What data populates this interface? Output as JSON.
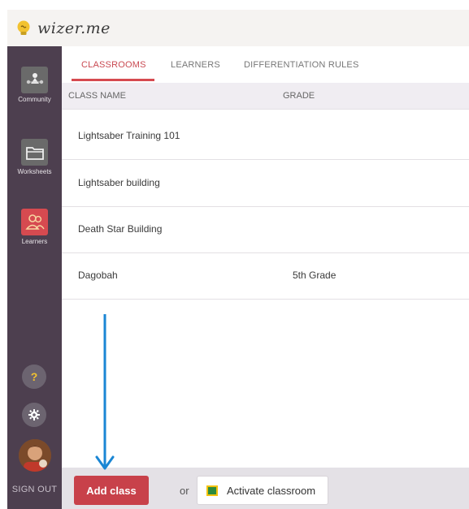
{
  "brand": {
    "name": "wizer.me"
  },
  "sidebar": {
    "items": [
      {
        "label": "Community",
        "icon": "community-icon"
      },
      {
        "label": "Worksheets",
        "icon": "folder-icon"
      },
      {
        "label": "Learners",
        "icon": "learners-icon",
        "active": true
      }
    ],
    "help_label": "?",
    "signout_label": "SIGN OUT"
  },
  "tabs": [
    {
      "label": "CLASSROOMS",
      "active": true
    },
    {
      "label": "LEARNERS",
      "active": false
    },
    {
      "label": "DIFFERENTIATION RULES",
      "active": false
    }
  ],
  "table": {
    "columns": [
      "CLASS NAME",
      "GRADE"
    ],
    "rows": [
      {
        "name": "Lightsaber Training 101",
        "grade": ""
      },
      {
        "name": "Lightsaber building",
        "grade": ""
      },
      {
        "name": "Death Star Building",
        "grade": ""
      },
      {
        "name": "Dagobah",
        "grade": "5th Grade"
      }
    ]
  },
  "footer": {
    "add_class_label": "Add class",
    "or_label": "or",
    "activate_label": "Activate classroom"
  },
  "colors": {
    "accent": "#d64a50",
    "sidebar": "#4d3f4f",
    "annotation_arrow": "#1a86d4"
  }
}
